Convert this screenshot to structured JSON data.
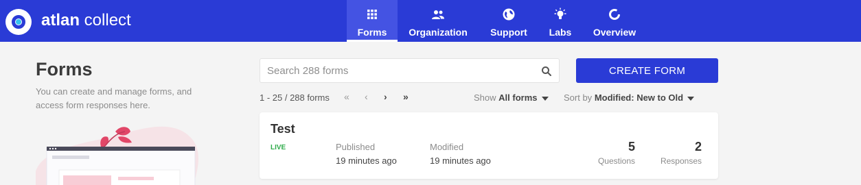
{
  "header": {
    "brand_bold": "atlan",
    "brand_light": " collect",
    "nav": [
      {
        "label": "Forms",
        "icon": "grid-icon",
        "active": true
      },
      {
        "label": "Organization",
        "icon": "people-icon"
      },
      {
        "label": "Support",
        "icon": "globe-icon"
      },
      {
        "label": "Labs",
        "icon": "bulb-icon"
      },
      {
        "label": "Overview",
        "icon": "donut-chart-icon"
      }
    ]
  },
  "sidebar": {
    "title": "Forms",
    "description": "You can create and manage forms, and access form responses here."
  },
  "search": {
    "placeholder": "Search 288 forms"
  },
  "create_button": "CREATE FORM",
  "pagination": {
    "range": "1 - 25 / 288 forms",
    "first": "«",
    "prev": "‹",
    "next": "›",
    "last": "»"
  },
  "filters": {
    "show_label": "Show",
    "show_value": "All forms",
    "sort_label": "Sort by",
    "sort_value": "Modified: New to Old"
  },
  "forms": [
    {
      "title": "Test",
      "status": "LIVE",
      "published_label": "Published",
      "published_value": "19 minutes ago",
      "modified_label": "Modified",
      "modified_value": "19 minutes ago",
      "questions": "5",
      "questions_label": "Questions",
      "responses": "2",
      "responses_label": "Responses"
    }
  ],
  "colors": {
    "primary": "#2a3bd6",
    "live": "#2eab4a"
  }
}
